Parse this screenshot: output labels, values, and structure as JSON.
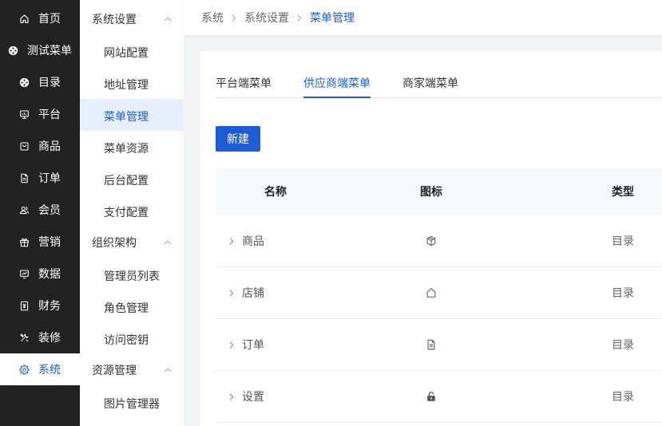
{
  "sidebar": {
    "items": [
      {
        "label": "首页",
        "icon": "home-icon"
      },
      {
        "label": "测试菜单",
        "icon": "aperture-icon"
      },
      {
        "label": "目录",
        "icon": "aperture-icon"
      },
      {
        "label": "平台",
        "icon": "monitor-icon"
      },
      {
        "label": "商品",
        "icon": "bag-icon"
      },
      {
        "label": "订单",
        "icon": "document-icon"
      },
      {
        "label": "会员",
        "icon": "users-icon"
      },
      {
        "label": "营销",
        "icon": "gift-icon"
      },
      {
        "label": "数据",
        "icon": "chart-icon"
      },
      {
        "label": "财务",
        "icon": "finance-icon"
      },
      {
        "label": "装修",
        "icon": "tools-icon"
      },
      {
        "label": "系统",
        "icon": "gear-icon",
        "active": true
      }
    ]
  },
  "submenu": {
    "groups": [
      {
        "title": "系统设置",
        "expanded": true,
        "items": [
          {
            "label": "网站配置"
          },
          {
            "label": "地址管理"
          },
          {
            "label": "菜单管理",
            "active": true
          },
          {
            "label": "菜单资源"
          },
          {
            "label": "后台配置"
          },
          {
            "label": "支付配置"
          }
        ]
      },
      {
        "title": "组织架构",
        "expanded": true,
        "items": [
          {
            "label": "管理员列表"
          },
          {
            "label": "角色管理"
          },
          {
            "label": "访问密钥"
          }
        ]
      },
      {
        "title": "资源管理",
        "expanded": true,
        "items": [
          {
            "label": "图片管理器"
          }
        ]
      }
    ]
  },
  "breadcrumb": [
    {
      "label": "系统"
    },
    {
      "label": "系统设置"
    },
    {
      "label": "菜单管理",
      "current": true
    }
  ],
  "tabs": [
    {
      "label": "平台端菜单"
    },
    {
      "label": "供应商端菜单",
      "active": true
    },
    {
      "label": "商家端菜单"
    }
  ],
  "toolbar": {
    "new_label": "新建"
  },
  "table": {
    "columns": [
      "名称",
      "图标",
      "类型"
    ],
    "rows": [
      {
        "name": "商品",
        "icon": "cube-icon",
        "type": "目录"
      },
      {
        "name": "店铺",
        "icon": "house-icon",
        "type": "目录"
      },
      {
        "name": "订单",
        "icon": "document-icon",
        "type": "目录"
      },
      {
        "name": "设置",
        "icon": "lock-icon",
        "type": "目录"
      }
    ]
  },
  "colors": {
    "accent": "#1c5cd5",
    "sidebar_bg": "#222222",
    "submenu_active_bg": "#e7eefc",
    "page_bg": "#f2f3f5",
    "table_header_bg": "#f7f8fa"
  }
}
